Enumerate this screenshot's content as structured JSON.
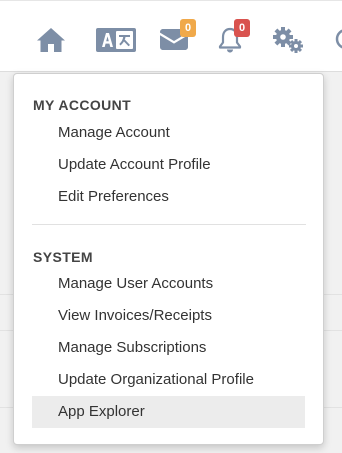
{
  "toolbar": {
    "icons": [
      "home-icon",
      "language-icon",
      "mail-icon",
      "bell-icon",
      "gears-icon",
      "search-icon"
    ],
    "mail_badge": "0",
    "notification_badge": "0",
    "colors": {
      "icon": "#7d8ea6",
      "badge_mail": "#f0a94a",
      "badge_notification": "#d9534f"
    }
  },
  "dropdown": {
    "my_account": {
      "title": "MY ACCOUNT",
      "items": [
        {
          "label": "Manage Account"
        },
        {
          "label": "Update Account Profile"
        },
        {
          "label": "Edit Preferences"
        }
      ]
    },
    "system": {
      "title": "SYSTEM",
      "items": [
        {
          "label": "Manage User Accounts"
        },
        {
          "label": "View Invoices/Receipts"
        },
        {
          "label": "Manage Subscriptions"
        },
        {
          "label": "Update Organizational Profile"
        },
        {
          "label": "App Explorer",
          "highlighted": true
        }
      ]
    }
  }
}
